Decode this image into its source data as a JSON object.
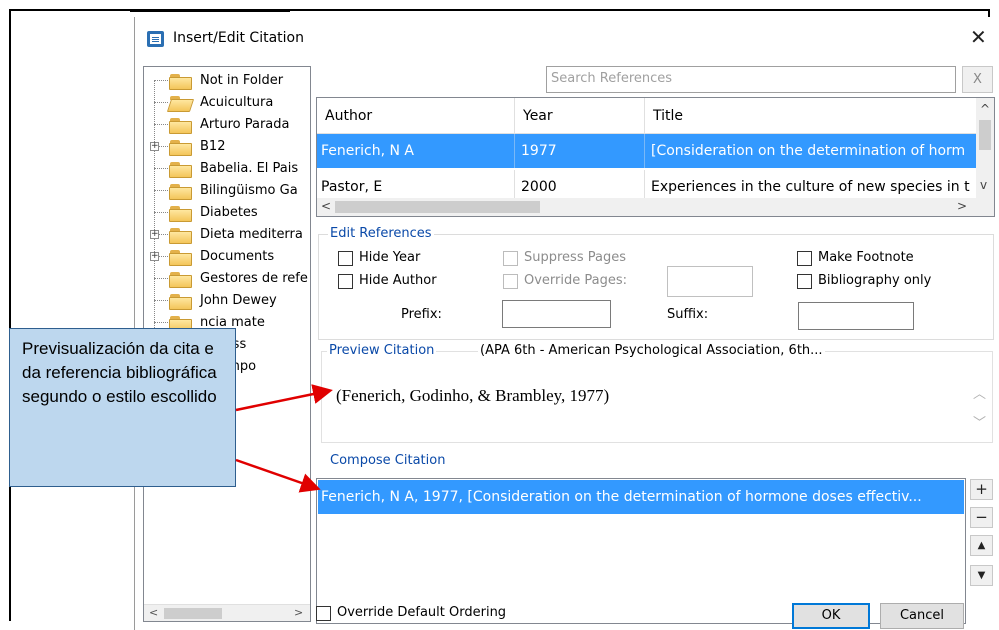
{
  "dialog": {
    "title": "Insert/Edit Citation",
    "close_glyph": "✕"
  },
  "folders": [
    {
      "label": "Not in Folder",
      "expandable": false,
      "open": false
    },
    {
      "label": "Acuicultura",
      "expandable": false,
      "open": true
    },
    {
      "label": "Arturo Parada",
      "expandable": false,
      "open": false
    },
    {
      "label": "B12",
      "expandable": true,
      "open": false
    },
    {
      "label": "Babelia. El Pais",
      "expandable": false,
      "open": false
    },
    {
      "label": "Bilingüismo Ga",
      "expandable": false,
      "open": false
    },
    {
      "label": "Diabetes",
      "expandable": false,
      "open": false
    },
    {
      "label": "Dieta mediterra",
      "expandable": true,
      "open": false
    },
    {
      "label": "Documents",
      "expandable": true,
      "open": false
    },
    {
      "label": "Gestores de refe",
      "expandable": false,
      "open": false
    },
    {
      "label": "John Dewey",
      "expandable": false,
      "open": false
    },
    {
      "label": "ncia mate",
      "expandable": false,
      "open": false
    },
    {
      "label": "fulness",
      "expandable": false,
      "open": false
    },
    {
      "label": "a campo",
      "expandable": false,
      "open": false
    }
  ],
  "search": {
    "placeholder": "Search References",
    "clear_label": "X"
  },
  "references": {
    "columns": [
      "Author",
      "Year",
      "Title"
    ],
    "rows": [
      {
        "author": "Fenerich, N A",
        "year": "1977",
        "title": "[Consideration on the determination of horm",
        "selected": true
      },
      {
        "author": "Pastor, E",
        "year": "2000",
        "title": "Experiences in the culture of new species in t",
        "selected": false
      }
    ]
  },
  "edit_references": {
    "title": "Edit References",
    "hide_year": "Hide Year",
    "hide_author": "Hide Author",
    "suppress_pages": "Suppress Pages",
    "override_pages": "Override Pages:",
    "make_footnote": "Make Footnote",
    "bibliography_only": "Bibliography only",
    "prefix": "Prefix:",
    "suffix": "Suffix:"
  },
  "preview": {
    "title": "Preview Citation",
    "style": "(APA 6th - American Psychological Association, 6th...",
    "text": "(Fenerich, Godinho, & Brambley, 1977)"
  },
  "compose": {
    "title": "Compose Citation",
    "item": "Fenerich, N A, 1977, [Consideration on the determination of hormone doses effectiv...",
    "add_glyph": "+",
    "remove_glyph": "−",
    "up_glyph": "▲",
    "down_glyph": "▼"
  },
  "footer": {
    "override_ordering": "Override Default Ordering",
    "ok": "OK",
    "cancel": "Cancel"
  },
  "callout": {
    "text": "Previsualización da cita e da referencia bibliográfica segundo o estilo escollido"
  },
  "colors": {
    "selection": "#3399ff",
    "group_title": "#0a49a8",
    "callout_fill": "#bdd7ee",
    "arrow": "#e00000"
  }
}
